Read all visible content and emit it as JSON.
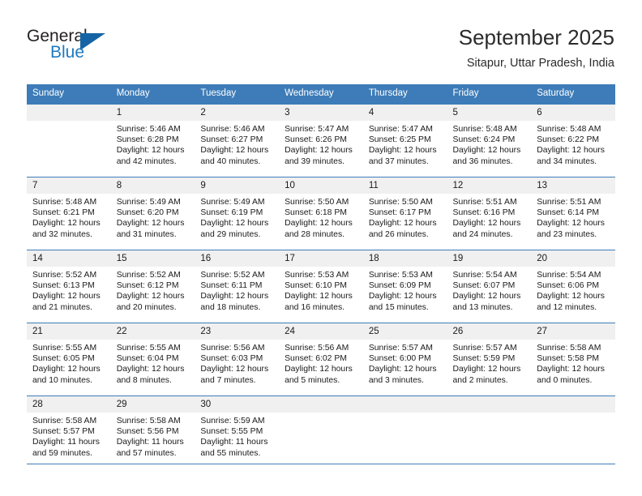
{
  "brand": {
    "word_one": "General",
    "word_two": "Blue",
    "triangle_icon": "blue-triangle-logo-mark",
    "accent_color": "#1f7ac0",
    "mark_color": "#1464a5"
  },
  "header": {
    "title": "September 2025",
    "location": "Sitapur, Uttar Pradesh, India"
  },
  "calendar": {
    "header_bg_color": "#3d7cb8",
    "daynum_bg_color": "#f0f0f0",
    "weekday_headers": [
      "Sunday",
      "Monday",
      "Tuesday",
      "Wednesday",
      "Thursday",
      "Friday",
      "Saturday"
    ],
    "weeks": [
      [
        {
          "day": "",
          "empty": true
        },
        {
          "day": "1",
          "sunrise": "Sunrise: 5:46 AM",
          "sunset": "Sunset: 6:28 PM",
          "daylight": "Daylight: 12 hours and 42 minutes."
        },
        {
          "day": "2",
          "sunrise": "Sunrise: 5:46 AM",
          "sunset": "Sunset: 6:27 PM",
          "daylight": "Daylight: 12 hours and 40 minutes."
        },
        {
          "day": "3",
          "sunrise": "Sunrise: 5:47 AM",
          "sunset": "Sunset: 6:26 PM",
          "daylight": "Daylight: 12 hours and 39 minutes."
        },
        {
          "day": "4",
          "sunrise": "Sunrise: 5:47 AM",
          "sunset": "Sunset: 6:25 PM",
          "daylight": "Daylight: 12 hours and 37 minutes."
        },
        {
          "day": "5",
          "sunrise": "Sunrise: 5:48 AM",
          "sunset": "Sunset: 6:24 PM",
          "daylight": "Daylight: 12 hours and 36 minutes."
        },
        {
          "day": "6",
          "sunrise": "Sunrise: 5:48 AM",
          "sunset": "Sunset: 6:22 PM",
          "daylight": "Daylight: 12 hours and 34 minutes."
        }
      ],
      [
        {
          "day": "7",
          "sunrise": "Sunrise: 5:48 AM",
          "sunset": "Sunset: 6:21 PM",
          "daylight": "Daylight: 12 hours and 32 minutes."
        },
        {
          "day": "8",
          "sunrise": "Sunrise: 5:49 AM",
          "sunset": "Sunset: 6:20 PM",
          "daylight": "Daylight: 12 hours and 31 minutes."
        },
        {
          "day": "9",
          "sunrise": "Sunrise: 5:49 AM",
          "sunset": "Sunset: 6:19 PM",
          "daylight": "Daylight: 12 hours and 29 minutes."
        },
        {
          "day": "10",
          "sunrise": "Sunrise: 5:50 AM",
          "sunset": "Sunset: 6:18 PM",
          "daylight": "Daylight: 12 hours and 28 minutes."
        },
        {
          "day": "11",
          "sunrise": "Sunrise: 5:50 AM",
          "sunset": "Sunset: 6:17 PM",
          "daylight": "Daylight: 12 hours and 26 minutes."
        },
        {
          "day": "12",
          "sunrise": "Sunrise: 5:51 AM",
          "sunset": "Sunset: 6:16 PM",
          "daylight": "Daylight: 12 hours and 24 minutes."
        },
        {
          "day": "13",
          "sunrise": "Sunrise: 5:51 AM",
          "sunset": "Sunset: 6:14 PM",
          "daylight": "Daylight: 12 hours and 23 minutes."
        }
      ],
      [
        {
          "day": "14",
          "sunrise": "Sunrise: 5:52 AM",
          "sunset": "Sunset: 6:13 PM",
          "daylight": "Daylight: 12 hours and 21 minutes."
        },
        {
          "day": "15",
          "sunrise": "Sunrise: 5:52 AM",
          "sunset": "Sunset: 6:12 PM",
          "daylight": "Daylight: 12 hours and 20 minutes."
        },
        {
          "day": "16",
          "sunrise": "Sunrise: 5:52 AM",
          "sunset": "Sunset: 6:11 PM",
          "daylight": "Daylight: 12 hours and 18 minutes."
        },
        {
          "day": "17",
          "sunrise": "Sunrise: 5:53 AM",
          "sunset": "Sunset: 6:10 PM",
          "daylight": "Daylight: 12 hours and 16 minutes."
        },
        {
          "day": "18",
          "sunrise": "Sunrise: 5:53 AM",
          "sunset": "Sunset: 6:09 PM",
          "daylight": "Daylight: 12 hours and 15 minutes."
        },
        {
          "day": "19",
          "sunrise": "Sunrise: 5:54 AM",
          "sunset": "Sunset: 6:07 PM",
          "daylight": "Daylight: 12 hours and 13 minutes."
        },
        {
          "day": "20",
          "sunrise": "Sunrise: 5:54 AM",
          "sunset": "Sunset: 6:06 PM",
          "daylight": "Daylight: 12 hours and 12 minutes."
        }
      ],
      [
        {
          "day": "21",
          "sunrise": "Sunrise: 5:55 AM",
          "sunset": "Sunset: 6:05 PM",
          "daylight": "Daylight: 12 hours and 10 minutes."
        },
        {
          "day": "22",
          "sunrise": "Sunrise: 5:55 AM",
          "sunset": "Sunset: 6:04 PM",
          "daylight": "Daylight: 12 hours and 8 minutes."
        },
        {
          "day": "23",
          "sunrise": "Sunrise: 5:56 AM",
          "sunset": "Sunset: 6:03 PM",
          "daylight": "Daylight: 12 hours and 7 minutes."
        },
        {
          "day": "24",
          "sunrise": "Sunrise: 5:56 AM",
          "sunset": "Sunset: 6:02 PM",
          "daylight": "Daylight: 12 hours and 5 minutes."
        },
        {
          "day": "25",
          "sunrise": "Sunrise: 5:57 AM",
          "sunset": "Sunset: 6:00 PM",
          "daylight": "Daylight: 12 hours and 3 minutes."
        },
        {
          "day": "26",
          "sunrise": "Sunrise: 5:57 AM",
          "sunset": "Sunset: 5:59 PM",
          "daylight": "Daylight: 12 hours and 2 minutes."
        },
        {
          "day": "27",
          "sunrise": "Sunrise: 5:58 AM",
          "sunset": "Sunset: 5:58 PM",
          "daylight": "Daylight: 12 hours and 0 minutes."
        }
      ],
      [
        {
          "day": "28",
          "sunrise": "Sunrise: 5:58 AM",
          "sunset": "Sunset: 5:57 PM",
          "daylight": "Daylight: 11 hours and 59 minutes."
        },
        {
          "day": "29",
          "sunrise": "Sunrise: 5:58 AM",
          "sunset": "Sunset: 5:56 PM",
          "daylight": "Daylight: 11 hours and 57 minutes."
        },
        {
          "day": "30",
          "sunrise": "Sunrise: 5:59 AM",
          "sunset": "Sunset: 5:55 PM",
          "daylight": "Daylight: 11 hours and 55 minutes."
        },
        {
          "day": "",
          "empty": true
        },
        {
          "day": "",
          "empty": true
        },
        {
          "day": "",
          "empty": true
        },
        {
          "day": "",
          "empty": true
        }
      ]
    ]
  }
}
